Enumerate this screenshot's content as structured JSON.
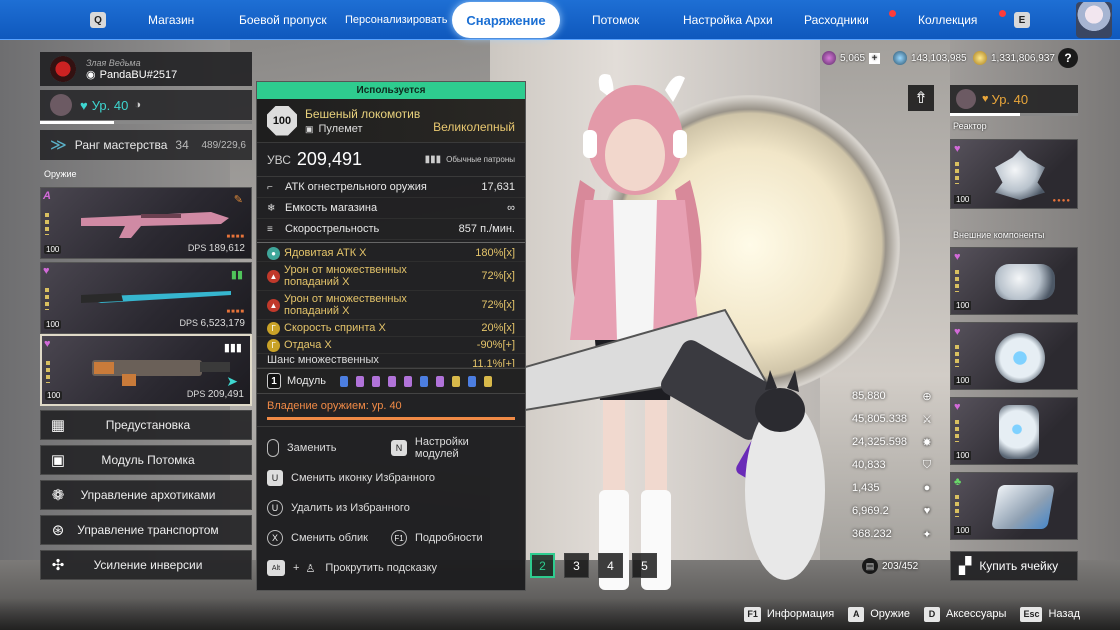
{
  "nav": {
    "key_left": "Q",
    "key_right": "E",
    "items": [
      "Магазин",
      "Боевой пропуск",
      "Персонализировать",
      "Снаряжение",
      "Потомок",
      "Настройка Архи",
      "Расходники",
      "Коллекция"
    ],
    "active": "Снаряжение"
  },
  "profile": {
    "title": "Злая Ведьма",
    "name": "PandaBU#2517",
    "level": "Ур. 40",
    "mastery_label": "Ранг мастерства",
    "mastery_rank": "34",
    "mastery_progress": "489/229,6"
  },
  "weapons": {
    "section_label": "Оружие",
    "cards": [
      {
        "dps_label": "DPS",
        "dps": "189,612",
        "level": "100"
      },
      {
        "dps_label": "DPS",
        "dps": "6,523,179",
        "level": "100"
      },
      {
        "dps_label": "DPS",
        "dps": "209,491",
        "level": "100"
      }
    ]
  },
  "side_buttons": [
    "Предустановка",
    "Модуль Потомка",
    "Управление архотиками",
    "Управление транспортом",
    "Усиление инверсии"
  ],
  "detail": {
    "in_use": "Используется",
    "level": "100",
    "name": "Бешеный локомотив",
    "type": "Пулемет",
    "rarity": "Великолепный",
    "uvs_label": "УВС",
    "uvs_value": "209,491",
    "ammo": "Обычные патроны",
    "stats": [
      {
        "label": "АТК огнестрельного оружия",
        "value": "17,631"
      },
      {
        "label": "Емкость магазина",
        "value": "∞"
      },
      {
        "label": "Скорострельность",
        "value": "857 п./мин."
      }
    ],
    "mods": [
      {
        "label": "Ядовитая АТК X",
        "value": "180%[x]",
        "color": "#3fa69a"
      },
      {
        "label": "Урон от множественных попаданий X",
        "value": "72%[x]",
        "color": "#c0392b"
      },
      {
        "label": "Урон от множественных попаданий X",
        "value": "72%[x]",
        "color": "#c0392b"
      },
      {
        "label": "Скорость спринта X",
        "value": "20%[x]",
        "color": "#c9a227"
      },
      {
        "label": "Отдача X",
        "value": "-90%[+]",
        "color": "#c9a227"
      },
      {
        "label": "Шанс множественных",
        "value": "11.1%[+]",
        "color": "#c9a227"
      }
    ],
    "module_label": "Модуль",
    "module_count": "1",
    "module_colors": [
      "#4c7ee0",
      "#b173d9",
      "#b173d9",
      "#b173d9",
      "#b173d9",
      "#4c7ee0",
      "#b173d9",
      "#d8b94a",
      "#4c7ee0",
      "#d8b94a"
    ],
    "mastery": "Владение оружием: ур. 40",
    "actions": [
      {
        "key": "",
        "label": "Заменить"
      },
      {
        "key": "N",
        "label": "Настройки модулей"
      },
      {
        "key": "U",
        "label": "Сменить иконку Избранного"
      },
      {
        "key": "U",
        "label": "Удалить из Избранного"
      },
      {
        "key": "X",
        "label": "Сменить облик"
      },
      {
        "key": "F1",
        "label": "Подробности"
      },
      {
        "key": "Alt",
        "label": "Прокрутить подсказку"
      }
    ]
  },
  "currency": [
    "5,065",
    "143,103,985",
    "1,331,806,937"
  ],
  "right": {
    "level": "Ур. 40",
    "reactor_label": "Реактор",
    "external_label": "Внешние компоненты",
    "buy_label": "Купить ячейку",
    "card_level": "100"
  },
  "stats": [
    "85,880",
    "45,805.338",
    "24,325.598",
    "40,833",
    "1,435",
    "6,969.2",
    "368.232"
  ],
  "inventory": "203/452",
  "pages": [
    "2",
    "3",
    "4",
    "5"
  ],
  "bottom": [
    {
      "key": "F1",
      "label": "Информация"
    },
    {
      "key": "A",
      "label": "Оружие"
    },
    {
      "key": "D",
      "label": "Аксессуары"
    },
    {
      "key": "Esc",
      "label": "Назад"
    }
  ]
}
